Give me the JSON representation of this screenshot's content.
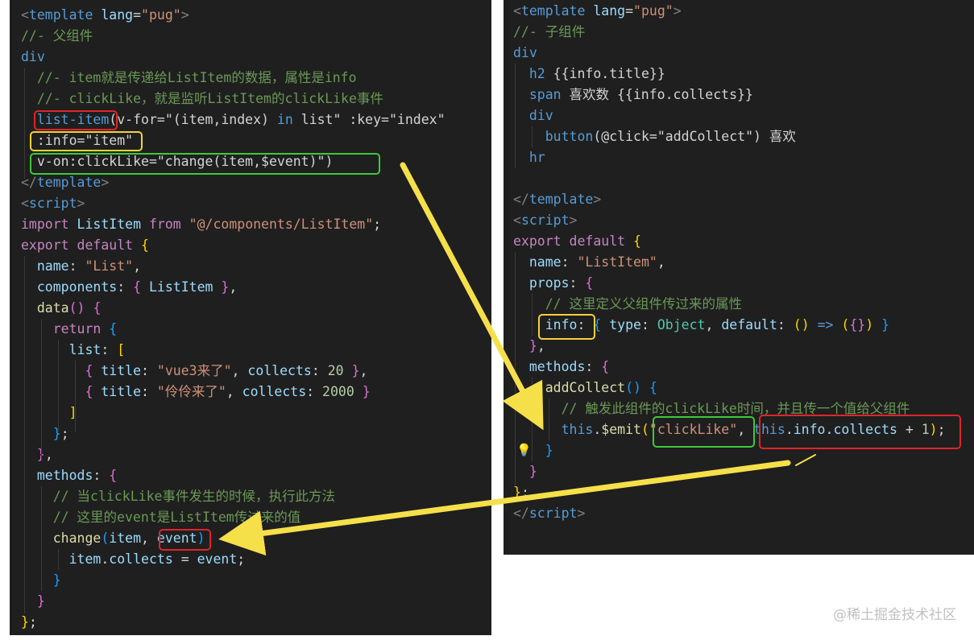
{
  "highlight_colors": {
    "red": "#e0242b",
    "yellow": "#f2d338",
    "green": "#3ec93b",
    "arrow": "#f6e04a"
  },
  "icons": [
    "lightbulb-icon"
  ],
  "watermark": "@稀土掘金技术社区",
  "left": {
    "lines": [
      [
        [
          "t-gray",
          "<"
        ],
        [
          "t-tag",
          "template"
        ],
        [
          "t-plain",
          " "
        ],
        [
          "t-attr",
          "lang"
        ],
        [
          "t-plain",
          "="
        ],
        [
          "t-str",
          "\"pug\""
        ],
        [
          "t-gray",
          ">"
        ]
      ],
      [
        [
          "t-com",
          "//- 父组件"
        ]
      ],
      [
        [
          "t-tag",
          "div"
        ]
      ],
      [
        [
          "t-plain",
          "  "
        ],
        [
          "t-com",
          "//- item就是传递给ListItem的数据，属性是info"
        ]
      ],
      [
        [
          "t-plain",
          "  "
        ],
        [
          "t-com",
          "//- clickLike，就是监听ListItem的clickLike事件"
        ]
      ],
      [
        [
          "t-plain",
          "  "
        ],
        [
          "t-tag",
          "list-item"
        ],
        [
          "t-plain",
          "(v-for=\"(item,index) "
        ],
        [
          "t-tag",
          "in"
        ],
        [
          "t-plain",
          " list\" :key=\"index\""
        ]
      ],
      [
        [
          "t-plain",
          "  :info=\"item\""
        ]
      ],
      [
        [
          "t-plain",
          "  v-on:clickLike=\"change(item,$event)\")"
        ]
      ],
      [
        [
          "t-gray",
          "</"
        ],
        [
          "t-tag",
          "template"
        ],
        [
          "t-gray",
          ">"
        ]
      ],
      [
        [
          "t-gray",
          "<"
        ],
        [
          "t-tag",
          "script"
        ],
        [
          "t-gray",
          ">"
        ]
      ],
      [
        [
          "t-kw",
          "import"
        ],
        [
          "t-plain",
          " "
        ],
        [
          "t-var",
          "ListItem"
        ],
        [
          "t-plain",
          " "
        ],
        [
          "t-kw",
          "from"
        ],
        [
          "t-plain",
          " "
        ],
        [
          "t-str",
          "\"@/components/ListItem\""
        ],
        [
          "t-plain",
          ";"
        ]
      ],
      [
        [
          "t-kw",
          "export"
        ],
        [
          "t-plain",
          " "
        ],
        [
          "t-kw",
          "default"
        ],
        [
          "t-plain",
          " "
        ],
        [
          "t-b1",
          "{"
        ]
      ],
      [
        [
          "t-plain",
          "  "
        ],
        [
          "t-var",
          "name"
        ],
        [
          "t-plain",
          ": "
        ],
        [
          "t-str",
          "\"List\""
        ],
        [
          "t-plain",
          ","
        ]
      ],
      [
        [
          "t-plain",
          "  "
        ],
        [
          "t-var",
          "components"
        ],
        [
          "t-plain",
          ": "
        ],
        [
          "t-b2",
          "{"
        ],
        [
          "t-plain",
          " "
        ],
        [
          "t-var",
          "ListItem"
        ],
        [
          "t-plain",
          " "
        ],
        [
          "t-b2",
          "}"
        ],
        [
          "t-plain",
          ","
        ]
      ],
      [
        [
          "t-plain",
          "  "
        ],
        [
          "t-fn",
          "data"
        ],
        [
          "t-b2",
          "()"
        ],
        [
          "t-plain",
          " "
        ],
        [
          "t-b2",
          "{"
        ]
      ],
      [
        [
          "t-plain",
          "    "
        ],
        [
          "t-kw",
          "return"
        ],
        [
          "t-plain",
          " "
        ],
        [
          "t-b3",
          "{"
        ]
      ],
      [
        [
          "t-plain",
          "      "
        ],
        [
          "t-var",
          "list"
        ],
        [
          "t-plain",
          ": "
        ],
        [
          "t-b1",
          "["
        ]
      ],
      [
        [
          "t-plain",
          "        "
        ],
        [
          "t-b2",
          "{"
        ],
        [
          "t-plain",
          " "
        ],
        [
          "t-var",
          "title"
        ],
        [
          "t-plain",
          ": "
        ],
        [
          "t-str",
          "\"vue3来了\""
        ],
        [
          "t-plain",
          ", "
        ],
        [
          "t-var",
          "collects"
        ],
        [
          "t-plain",
          ": "
        ],
        [
          "t-num",
          "20"
        ],
        [
          "t-plain",
          " "
        ],
        [
          "t-b2",
          "}"
        ],
        [
          "t-plain",
          ","
        ]
      ],
      [
        [
          "t-plain",
          "        "
        ],
        [
          "t-b2",
          "{"
        ],
        [
          "t-plain",
          " "
        ],
        [
          "t-var",
          "title"
        ],
        [
          "t-plain",
          ": "
        ],
        [
          "t-str",
          "\"伶伶来了\""
        ],
        [
          "t-plain",
          ", "
        ],
        [
          "t-var",
          "collects"
        ],
        [
          "t-plain",
          ": "
        ],
        [
          "t-num",
          "2000"
        ],
        [
          "t-plain",
          " "
        ],
        [
          "t-b2",
          "}"
        ]
      ],
      [
        [
          "t-plain",
          "      "
        ],
        [
          "t-b1",
          "]"
        ]
      ],
      [
        [
          "t-plain",
          "    "
        ],
        [
          "t-b3",
          "}"
        ],
        [
          "t-plain",
          ";"
        ]
      ],
      [
        [
          "t-plain",
          "  "
        ],
        [
          "t-b2",
          "}"
        ],
        [
          "t-plain",
          ","
        ]
      ],
      [
        [
          "t-plain",
          "  "
        ],
        [
          "t-var",
          "methods"
        ],
        [
          "t-plain",
          ": "
        ],
        [
          "t-b2",
          "{"
        ]
      ],
      [
        [
          "t-plain",
          "    "
        ],
        [
          "t-com",
          "// 当clickLike事件发生的时候，执行此方法"
        ]
      ],
      [
        [
          "t-plain",
          "    "
        ],
        [
          "t-com",
          "// 这里的event是ListItem传过来的值"
        ]
      ],
      [
        [
          "t-plain",
          "    "
        ],
        [
          "t-fn",
          "change"
        ],
        [
          "t-b3",
          "("
        ],
        [
          "t-var",
          "item"
        ],
        [
          "t-plain",
          ", "
        ],
        [
          "t-var",
          "event"
        ],
        [
          "t-b3",
          ")"
        ]
      ],
      [
        [
          "t-plain",
          "      "
        ],
        [
          "t-var",
          "item"
        ],
        [
          "t-plain",
          "."
        ],
        [
          "t-var",
          "collects"
        ],
        [
          "t-plain",
          " = "
        ],
        [
          "t-var",
          "event"
        ],
        [
          "t-plain",
          ";"
        ]
      ],
      [
        [
          "t-plain",
          "    "
        ],
        [
          "t-b3",
          "}"
        ]
      ],
      [
        [
          "t-plain",
          "  "
        ],
        [
          "t-b2",
          "}"
        ]
      ],
      [
        [
          "t-b1",
          "}"
        ],
        [
          "t-plain",
          ";"
        ]
      ]
    ]
  },
  "right": {
    "lines": [
      [
        [
          "t-gray",
          "<"
        ],
        [
          "t-tag",
          "template"
        ],
        [
          "t-plain",
          " "
        ],
        [
          "t-attr",
          "lang"
        ],
        [
          "t-plain",
          "="
        ],
        [
          "t-str",
          "\"pug\""
        ],
        [
          "t-gray",
          ">"
        ]
      ],
      [
        [
          "t-com",
          "//- 子组件"
        ]
      ],
      [
        [
          "t-tag",
          "div"
        ]
      ],
      [
        [
          "t-plain",
          "  "
        ],
        [
          "t-tag",
          "h2"
        ],
        [
          "t-plain",
          " {{info.title}}"
        ]
      ],
      [
        [
          "t-plain",
          "  "
        ],
        [
          "t-tag",
          "span"
        ],
        [
          "t-plain",
          " 喜欢数 {{info.collects}}"
        ]
      ],
      [
        [
          "t-plain",
          "  "
        ],
        [
          "t-tag",
          "div"
        ]
      ],
      [
        [
          "t-plain",
          "    "
        ],
        [
          "t-tag",
          "button"
        ],
        [
          "t-plain",
          "(@click=\"addCollect\") 喜欢"
        ]
      ],
      [
        [
          "t-plain",
          "  "
        ],
        [
          "t-tag",
          "hr"
        ]
      ],
      [
        [
          "t-plain",
          ""
        ]
      ],
      [
        [
          "t-gray",
          "</"
        ],
        [
          "t-tag",
          "template"
        ],
        [
          "t-gray",
          ">"
        ]
      ],
      [
        [
          "t-gray",
          "<"
        ],
        [
          "t-tag",
          "script"
        ],
        [
          "t-gray",
          ">"
        ]
      ],
      [
        [
          "t-kw",
          "export"
        ],
        [
          "t-plain",
          " "
        ],
        [
          "t-kw",
          "default"
        ],
        [
          "t-plain",
          " "
        ],
        [
          "t-b1",
          "{"
        ]
      ],
      [
        [
          "t-plain",
          "  "
        ],
        [
          "t-var",
          "name"
        ],
        [
          "t-plain",
          ": "
        ],
        [
          "t-str",
          "\"ListItem\""
        ],
        [
          "t-plain",
          ","
        ]
      ],
      [
        [
          "t-plain",
          "  "
        ],
        [
          "t-var",
          "props"
        ],
        [
          "t-plain",
          ": "
        ],
        [
          "t-b2",
          "{"
        ]
      ],
      [
        [
          "t-plain",
          "    "
        ],
        [
          "t-com",
          "// 这里定义父组件传过来的属性"
        ]
      ],
      [
        [
          "t-plain",
          "    "
        ],
        [
          "t-var",
          "info"
        ],
        [
          "t-plain",
          ": "
        ],
        [
          "t-b3",
          "{"
        ],
        [
          "t-plain",
          " "
        ],
        [
          "t-var",
          "type"
        ],
        [
          "t-plain",
          ": "
        ],
        [
          "t-type",
          "Object"
        ],
        [
          "t-plain",
          ", "
        ],
        [
          "t-var",
          "default"
        ],
        [
          "t-plain",
          ": "
        ],
        [
          "t-b1",
          "()"
        ],
        [
          "t-plain",
          " "
        ],
        [
          "t-tag",
          "=>"
        ],
        [
          "t-plain",
          " "
        ],
        [
          "t-b1",
          "("
        ],
        [
          "t-b2",
          "{}"
        ],
        [
          "t-b1",
          ")"
        ],
        [
          "t-plain",
          " "
        ],
        [
          "t-b3",
          "}"
        ]
      ],
      [
        [
          "t-plain",
          "  "
        ],
        [
          "t-b2",
          "}"
        ],
        [
          "t-plain",
          ","
        ]
      ],
      [
        [
          "t-plain",
          "  "
        ],
        [
          "t-var",
          "methods"
        ],
        [
          "t-plain",
          ": "
        ],
        [
          "t-b2",
          "{"
        ]
      ],
      [
        [
          "t-plain",
          "    "
        ],
        [
          "t-fn",
          "addCollect"
        ],
        [
          "t-b3",
          "()"
        ],
        [
          "t-plain",
          " "
        ],
        [
          "t-b3",
          "{"
        ]
      ],
      [
        [
          "t-plain",
          "      "
        ],
        [
          "t-com",
          "// 触发此组件的clickLike时间，并且传一个值给父组件"
        ]
      ],
      [
        [
          "t-plain",
          "      "
        ],
        [
          "t-tag",
          "this"
        ],
        [
          "t-plain",
          "."
        ],
        [
          "t-fn",
          "$emit"
        ],
        [
          "t-b1",
          "("
        ],
        [
          "t-str",
          "\"clickLike\""
        ],
        [
          "t-plain",
          ", "
        ],
        [
          "t-tag",
          "this"
        ],
        [
          "t-plain",
          "."
        ],
        [
          "t-var",
          "info"
        ],
        [
          "t-plain",
          "."
        ],
        [
          "t-var",
          "collects"
        ],
        [
          "t-plain",
          " + "
        ],
        [
          "t-num",
          "1"
        ],
        [
          "t-b1",
          ")"
        ],
        [
          "t-plain",
          ";"
        ]
      ],
      [
        [
          "t-plain",
          "    "
        ],
        [
          "t-b3",
          "}"
        ]
      ],
      [
        [
          "t-plain",
          "  "
        ],
        [
          "t-b2",
          "}"
        ]
      ],
      [
        [
          "t-b1",
          "}"
        ],
        [
          "t-plain",
          ";"
        ]
      ],
      [
        [
          "t-gray",
          "</"
        ],
        [
          "t-tag",
          "script"
        ],
        [
          "t-gray",
          ">"
        ]
      ]
    ]
  }
}
